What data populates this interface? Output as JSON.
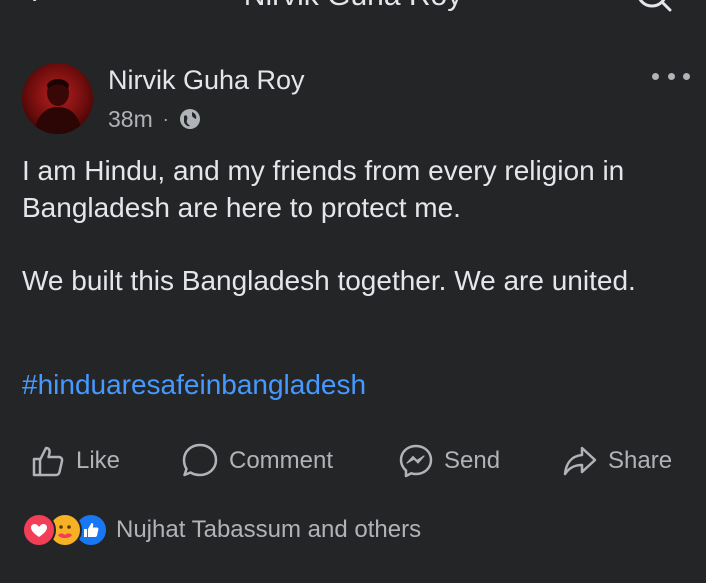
{
  "header": {
    "title": "Nirvik Guha Roy",
    "back_icon": "back-arrow-icon",
    "search_icon": "search-icon"
  },
  "post": {
    "author": "Nirvik Guha Roy",
    "time": "38m",
    "separator": "·",
    "audience_icon": "globe-icon",
    "paragraphs": [
      "I am Hindu, and my friends from every religion in Bangladesh are here to protect me.",
      "We built this Bangladesh together. We are united."
    ],
    "hashtag": "#hinduaresafeinbangladesh"
  },
  "actions": {
    "like": "Like",
    "comment": "Comment",
    "send": "Send",
    "share": "Share"
  },
  "reactions": {
    "icons": [
      "love-icon",
      "care-icon",
      "like-icon"
    ],
    "summary": "Nujhat Tabassum and others"
  },
  "colors": {
    "background": "#242526",
    "text": "#e4e6eb",
    "secondary": "#b0b3b8",
    "link": "#4599ff",
    "love": "#f33e58",
    "care": "#f7b125",
    "like": "#1877f2"
  }
}
